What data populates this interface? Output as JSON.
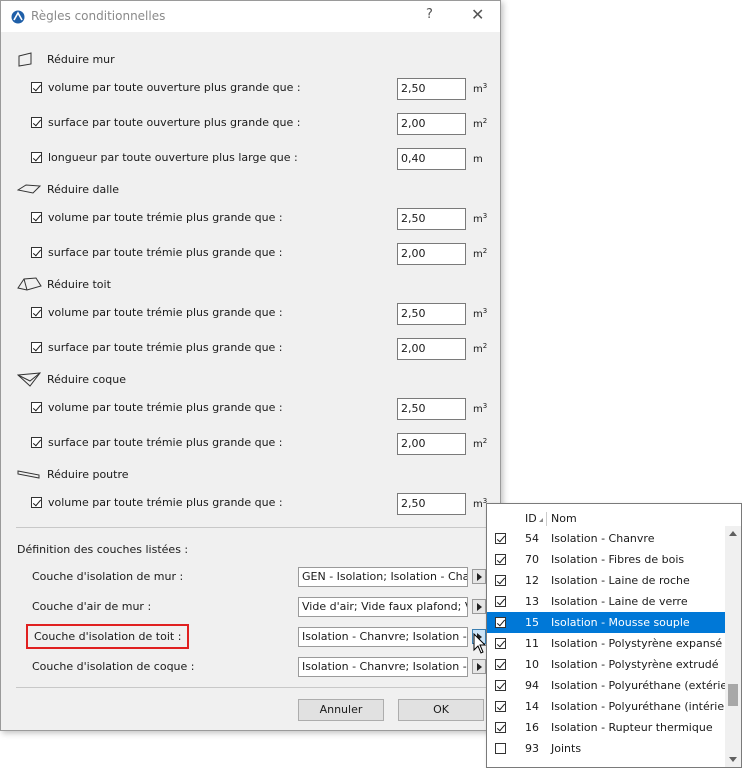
{
  "window": {
    "title": "Règles conditionnelles",
    "help": "?",
    "close": "✕"
  },
  "sections": [
    {
      "title": "Réduire mur",
      "icon": "wall-icon",
      "rows": [
        {
          "label": "volume par toute ouverture plus grande que :",
          "checked": true,
          "value": "2,50",
          "unit": "m",
          "exp": "3"
        },
        {
          "label": "surface par toute ouverture plus grande que :",
          "checked": true,
          "value": "2,00",
          "unit": "m",
          "exp": "2"
        },
        {
          "label": "longueur par toute ouverture plus large que :",
          "checked": true,
          "value": "0,40",
          "unit": "m",
          "exp": ""
        }
      ]
    },
    {
      "title": "Réduire dalle",
      "icon": "slab-icon",
      "rows": [
        {
          "label": "volume par toute trémie plus grande que :",
          "checked": true,
          "value": "2,50",
          "unit": "m",
          "exp": "3"
        },
        {
          "label": "surface par toute trémie plus grande que :",
          "checked": true,
          "value": "2,00",
          "unit": "m",
          "exp": "2"
        }
      ]
    },
    {
      "title": "Réduire toit",
      "icon": "roof-icon",
      "rows": [
        {
          "label": "volume par toute trémie plus grande que :",
          "checked": true,
          "value": "2,50",
          "unit": "m",
          "exp": "3"
        },
        {
          "label": "surface par toute trémie plus grande que :",
          "checked": true,
          "value": "2,00",
          "unit": "m",
          "exp": "2"
        }
      ]
    },
    {
      "title": "Réduire coque",
      "icon": "shell-icon",
      "rows": [
        {
          "label": "volume par toute trémie plus grande que :",
          "checked": true,
          "value": "2,50",
          "unit": "m",
          "exp": "3"
        },
        {
          "label": "surface par toute trémie plus grande que :",
          "checked": true,
          "value": "2,00",
          "unit": "m",
          "exp": "2"
        }
      ]
    },
    {
      "title": "Réduire poutre",
      "icon": "beam-icon",
      "rows": [
        {
          "label": "volume par toute trémie plus grande que :",
          "checked": true,
          "value": "2,50",
          "unit": "m",
          "exp": "3"
        }
      ]
    }
  ],
  "layers": {
    "title": "Définition des couches listées :",
    "rows": [
      {
        "label": "Couche d'isolation de mur :",
        "value": "GEN - Isolation; Isolation - Char",
        "highlight": false,
        "active": false
      },
      {
        "label": "Couche d'air de mur :",
        "value": "Vide d'air; Vide faux plafond; Vi",
        "highlight": false,
        "active": false
      },
      {
        "label": "Couche d'isolation de toit :",
        "value": "Isolation - Chanvre; Isolation - F",
        "highlight": true,
        "active": true
      },
      {
        "label": "Couche d'isolation de coque :",
        "value": "Isolation - Chanvre; Isolation - F",
        "highlight": false,
        "active": false
      }
    ]
  },
  "buttons": {
    "cancel": "Annuler",
    "ok": "OK"
  },
  "popup": {
    "col_id": "ID",
    "col_name": "Nom",
    "items": [
      {
        "checked": true,
        "id": "54",
        "name": "Isolation - Chanvre",
        "selected": false
      },
      {
        "checked": true,
        "id": "70",
        "name": "Isolation - Fibres de bois",
        "selected": false
      },
      {
        "checked": true,
        "id": "12",
        "name": "Isolation - Laine de roche",
        "selected": false
      },
      {
        "checked": true,
        "id": "13",
        "name": "Isolation - Laine de verre",
        "selected": false
      },
      {
        "checked": true,
        "id": "15",
        "name": "Isolation - Mousse souple",
        "selected": true
      },
      {
        "checked": true,
        "id": "11",
        "name": "Isolation - Polystyrène expansé",
        "selected": false
      },
      {
        "checked": true,
        "id": "10",
        "name": "Isolation - Polystyrène extrudé",
        "selected": false
      },
      {
        "checked": true,
        "id": "94",
        "name": "Isolation - Polyuréthane (extérieu",
        "selected": false
      },
      {
        "checked": true,
        "id": "14",
        "name": "Isolation - Polyuréthane (intérieu",
        "selected": false
      },
      {
        "checked": true,
        "id": "16",
        "name": "Isolation - Rupteur thermique",
        "selected": false
      },
      {
        "checked": false,
        "id": "93",
        "name": "Joints",
        "selected": false
      }
    ],
    "selected_color": "#0078d7"
  },
  "colors": {
    "highlight_border": "#e02020"
  }
}
